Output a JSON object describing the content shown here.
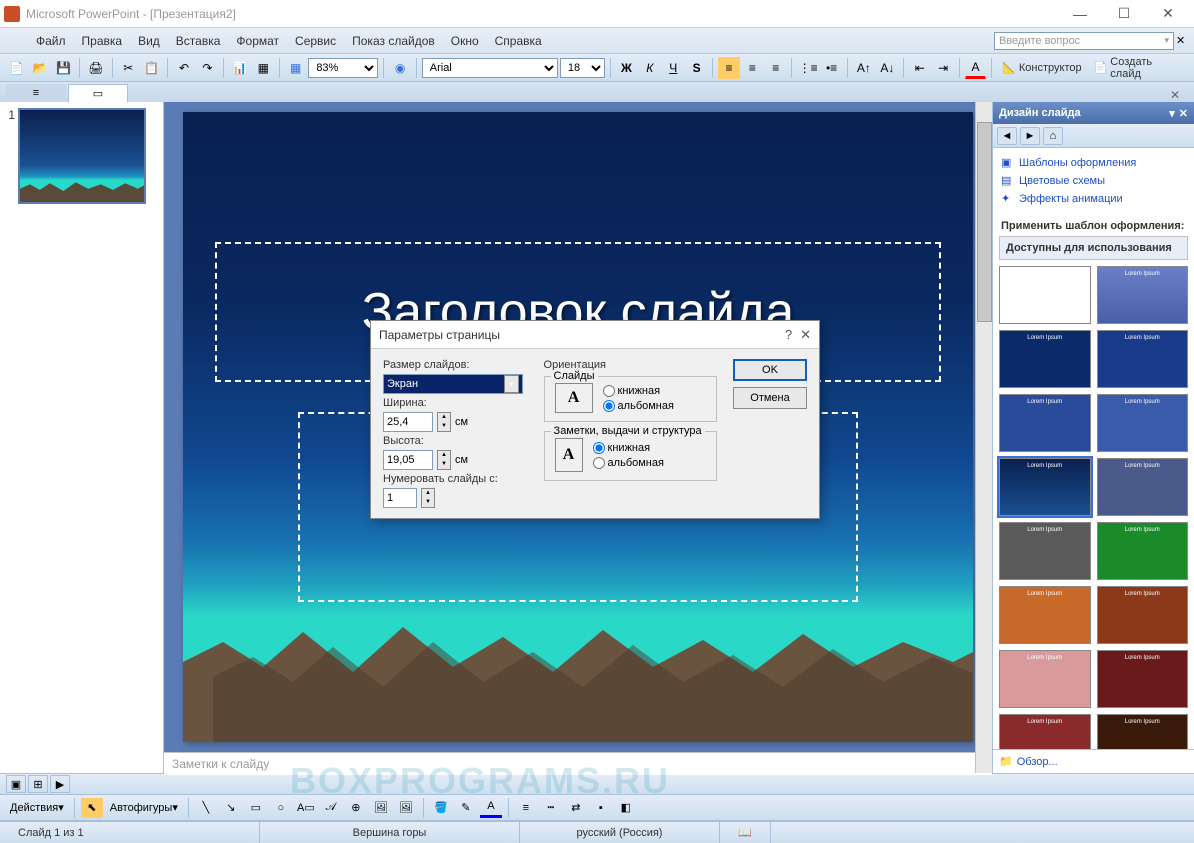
{
  "window": {
    "title": "Microsoft PowerPoint - [Презентация2]"
  },
  "menu": {
    "file": "Файл",
    "edit": "Правка",
    "view": "Вид",
    "insert": "Вставка",
    "format": "Формат",
    "tools": "Сервис",
    "slideshow": "Показ слайдов",
    "window": "Окно",
    "help": "Справка"
  },
  "help_box": "Введите вопрос",
  "toolbar": {
    "zoom": "83%",
    "font": "Arial",
    "font_size": "18",
    "designer": "Конструктор",
    "new_slide": "Создать слайд"
  },
  "slides": {
    "number": "1"
  },
  "slide_content": {
    "title": "Заголовок слайда"
  },
  "notes": "Заметки к слайду",
  "task_pane": {
    "title": "Дизайн слайда",
    "templates": "Шаблоны оформления",
    "colors": "Цветовые схемы",
    "effects": "Эффекты анимации",
    "apply_header": "Применить шаблон оформления:",
    "available": "Доступны для использования",
    "browse": "Обзор..."
  },
  "dialog": {
    "title": "Параметры страницы",
    "size_label": "Размер слайдов:",
    "size_value": "Экран",
    "width_label": "Ширина:",
    "width_value": "25,4",
    "height_label": "Высота:",
    "height_value": "19,05",
    "unit": "см",
    "number_from": "Нумеровать слайды с:",
    "number_value": "1",
    "orientation": "Ориентация",
    "slides_section": "Слайды",
    "notes_section": "Заметки, выдачи и структура",
    "portrait": "книжная",
    "landscape": "альбомная",
    "ok": "OK",
    "cancel": "Отмена"
  },
  "drawing": {
    "actions": "Действия",
    "autoshapes": "Автофигуры"
  },
  "status": {
    "slide": "Слайд 1 из 1",
    "layout": "Вершина горы",
    "lang": "русский (Россия)"
  },
  "watermark": "BOXPROGRAMS.RU"
}
